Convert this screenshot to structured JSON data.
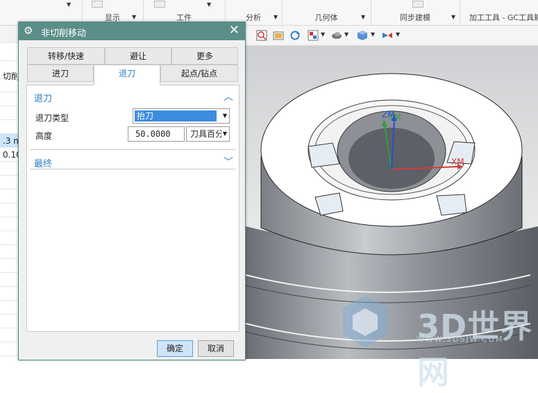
{
  "ribbon": {
    "groups": [
      {
        "label": "显示"
      },
      {
        "label": "工件"
      },
      {
        "label": "分析"
      },
      {
        "label": "几何体"
      },
      {
        "label": "同步建模"
      },
      {
        "label": "加工工具 - GC工具箱"
      }
    ]
  },
  "sheet": {
    "header": "切削",
    "cells": [
      ".3 m",
      "0.10"
    ]
  },
  "dialog": {
    "title": "非切削移动",
    "tabs_row1": [
      "转移/快速",
      "避让",
      "更多"
    ],
    "tabs_row2": [
      "进刀",
      "退刀",
      "起点/钻点"
    ],
    "active_tab": "退刀",
    "section_retract": {
      "title": "退刀",
      "type_label": "退刀类型",
      "type_value": "抬刀",
      "height_label": "高度",
      "height_value": "50.0000",
      "height_unit": "刀具百分比"
    },
    "section_final": {
      "title": "最终"
    },
    "ok_label": "确定",
    "cancel_label": "取消"
  },
  "viewport": {
    "axis_labels": {
      "zm": "ZM",
      "ym": "YM",
      "xm": "XM"
    },
    "watermark": "3D世界网",
    "watermark_url": "WWW.3DSJW.COM"
  },
  "colors": {
    "title_bar": "#5a8e89",
    "accent_blue": "#2a7fc2",
    "selection": "#3b8de0",
    "axis_x": "#d23b3b",
    "axis_y": "#2f9e44",
    "axis_z": "#1f4fd8"
  },
  "icons": {
    "settings": "gear-icon",
    "close": "close-icon",
    "collapse": "chevron-up-icon",
    "expand": "chevron-down-icon"
  }
}
